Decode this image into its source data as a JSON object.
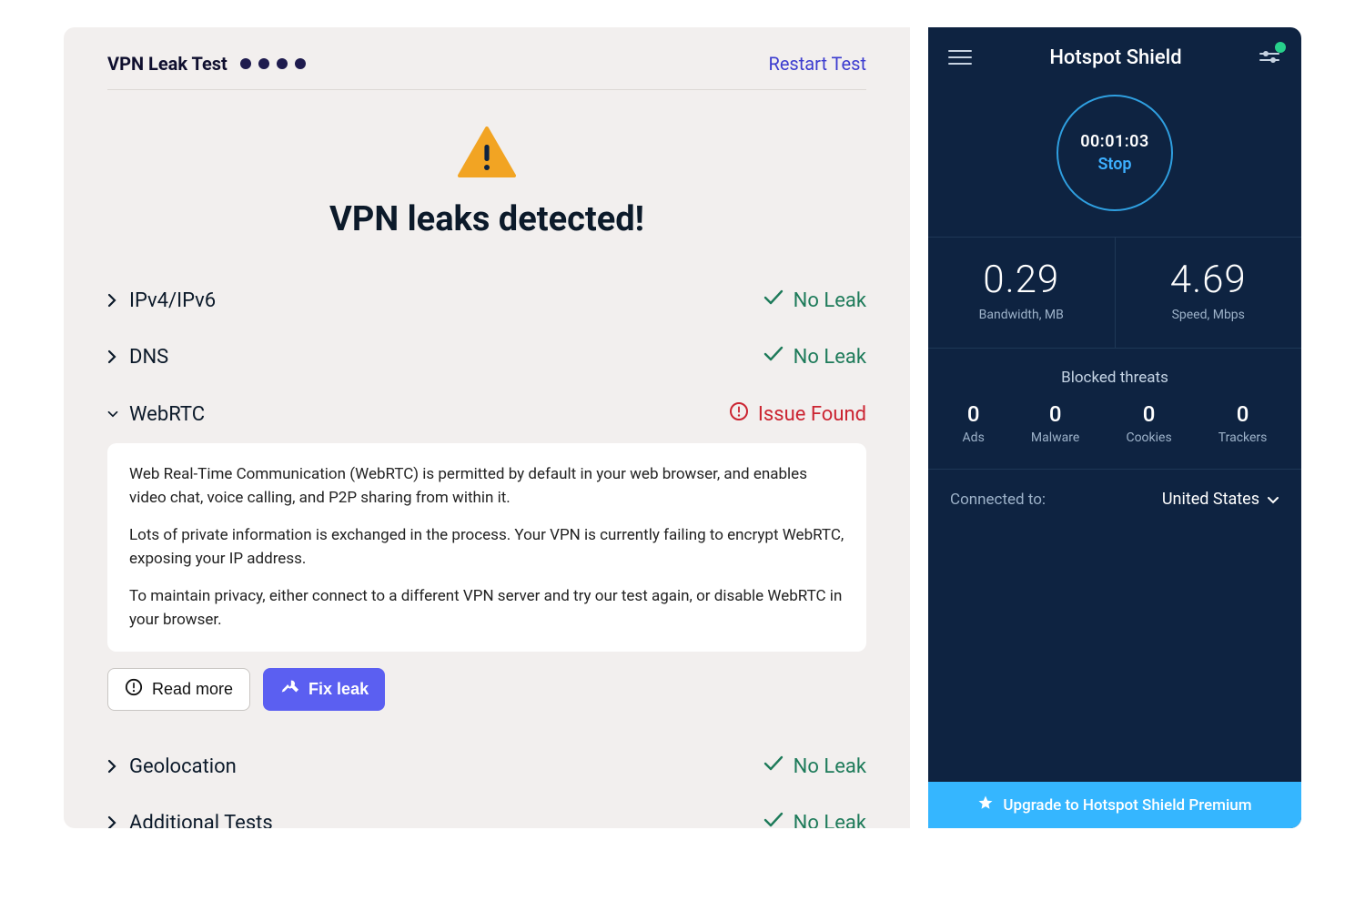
{
  "left": {
    "title": "VPN Leak Test",
    "dots": 4,
    "restart": "Restart Test",
    "alert_title": "VPN leaks detected!",
    "read_more": "Read more",
    "fix_leak": "Fix leak",
    "no_leak": "No Leak",
    "issue_found": "Issue Found",
    "tests": {
      "ipv": "IPv4/IPv6",
      "dns": "DNS",
      "webrtc": "WebRTC",
      "geo": "Geolocation",
      "additional": "Additional Tests"
    },
    "webrtc_detail": {
      "p1": "Web Real-Time Communication (WebRTC) is permitted by default in your web browser, and enables video chat, voice calling, and P2P sharing from within it.",
      "p2": "Lots of private information is exchanged in the process. Your VPN is currently failing to encrypt WebRTC, exposing your IP address.",
      "p3": "To maintain privacy, either connect to a different VPN server and try our test again, or disable WebRTC in your browser."
    }
  },
  "right": {
    "brand": "Hotspot Shield",
    "timer": "00:01:03",
    "stop": "Stop",
    "bandwidth_value": "0.29",
    "bandwidth_label": "Bandwidth, MB",
    "speed_value": "4.69",
    "speed_label": "Speed, Mbps",
    "threats_title": "Blocked threats",
    "threats": {
      "ads": {
        "value": "0",
        "label": "Ads"
      },
      "malware": {
        "value": "0",
        "label": "Malware"
      },
      "cookies": {
        "value": "0",
        "label": "Cookies"
      },
      "trackers": {
        "value": "0",
        "label": "Trackers"
      }
    },
    "connected_label": "Connected to:",
    "connected_value": "United States",
    "upgrade": "Upgrade to Hotspot Shield Premium"
  }
}
